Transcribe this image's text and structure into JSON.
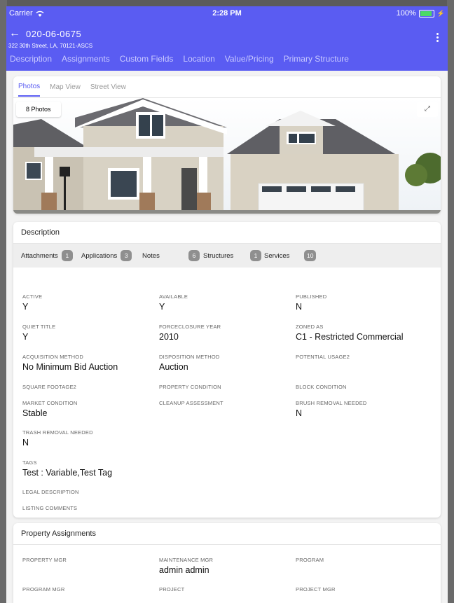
{
  "status_bar": {
    "carrier": "Carrier",
    "time": "2:28 PM",
    "battery": "100%"
  },
  "header": {
    "parcel_id": "020-06-0675",
    "address": "322 30th Street, LA, 70121-ASCS",
    "tabs": [
      "Description",
      "Assignments",
      "Custom Fields",
      "Location",
      "Value/Pricing",
      "Primary Structure"
    ]
  },
  "photo_card": {
    "tabs": [
      "Photos",
      "Map View",
      "Street View"
    ],
    "photos_button": "8 Photos"
  },
  "description": {
    "title": "Description",
    "counts": [
      {
        "label": "Attachments",
        "count": "1"
      },
      {
        "label": "Applications",
        "count": "3"
      },
      {
        "label": "Notes",
        "count": "6"
      },
      {
        "label": "Structures",
        "count": "1"
      },
      {
        "label": "Services",
        "count": "10"
      }
    ],
    "fields": {
      "active": {
        "label": "ACTIVE",
        "value": "Y"
      },
      "available": {
        "label": "AVAILABLE",
        "value": "Y"
      },
      "published": {
        "label": "PUBLISHED",
        "value": "N"
      },
      "quiet_title": {
        "label": "QUIET TITLE",
        "value": "Y"
      },
      "foreclosure_year": {
        "label": "FORCECLOSURE YEAR",
        "value": "2010"
      },
      "zoned_as": {
        "label": "ZONED AS",
        "value": "C1 - Restricted Commercial"
      },
      "acquisition_method": {
        "label": "ACQUISITION METHOD",
        "value": "No Minimum Bid Auction"
      },
      "disposition_method": {
        "label": "DISPOSITION METHOD",
        "value": "Auction"
      },
      "potential_usage": {
        "label": "POTENTIAL USAGE2",
        "value": ""
      },
      "square_footage": {
        "label": "SQUARE FOOTAGE2",
        "value": ""
      },
      "property_condition": {
        "label": "PROPERTY CONDITION",
        "value": ""
      },
      "block_condition": {
        "label": "BLOCK CONDITION",
        "value": ""
      },
      "market_condition": {
        "label": "MARKET CONDITION",
        "value": "Stable"
      },
      "cleanup_assessment": {
        "label": "CLEANUP ASSESSMENT",
        "value": ""
      },
      "brush_removal": {
        "label": "BRUSH REMOVAL NEEDED",
        "value": "N"
      },
      "trash_removal": {
        "label": "TRASH REMOVAL NEEDED",
        "value": "N"
      },
      "tags": {
        "label": "TAGS",
        "value": "Test : Variable,Test Tag"
      },
      "legal_description": {
        "label": "LEGAL DESCRIPTION",
        "value": ""
      },
      "listing_comments": {
        "label": "LISTING COMMENTS",
        "value": ""
      }
    }
  },
  "assignments": {
    "title": "Property Assignments",
    "fields": {
      "property_mgr": {
        "label": "PROPERTY MGR",
        "value": ""
      },
      "maintenance_mgr": {
        "label": "MAINTENANCE MGR",
        "value": "admin admin"
      },
      "program": {
        "label": "PROGRAM",
        "value": ""
      },
      "program_mgr": {
        "label": "PROGRAM MGR",
        "value": ""
      },
      "project": {
        "label": "PROJECT",
        "value": ""
      },
      "project_mgr": {
        "label": "PROJECT MGR",
        "value": ""
      }
    }
  },
  "colors": {
    "accent": "#5a5cf2",
    "badge": "#8f8f8f"
  }
}
